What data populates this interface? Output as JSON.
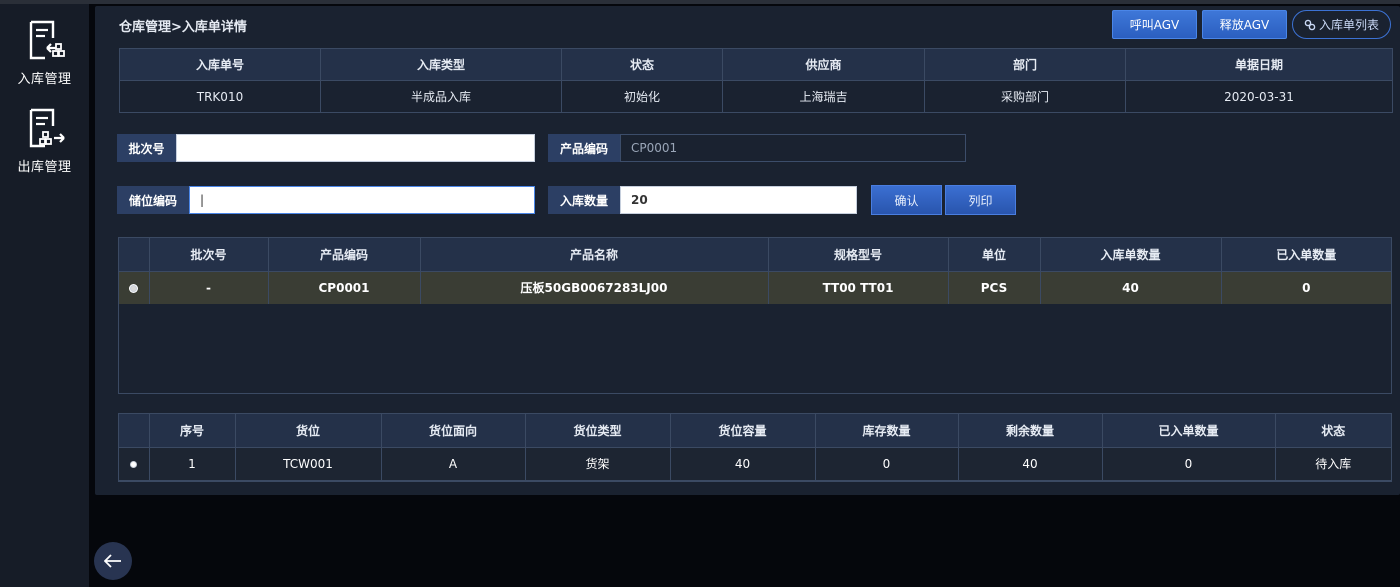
{
  "sidebar": {
    "items": [
      {
        "label": "入库管理",
        "icon": "inbound-doc-icon"
      },
      {
        "label": "出库管理",
        "icon": "outbound-doc-icon"
      }
    ]
  },
  "breadcrumb": "仓库管理>入库单详情",
  "toolbar": {
    "call_agv": "呼叫AGV",
    "release_agv": "释放AGV",
    "list": "入库单列表"
  },
  "order": {
    "headers": [
      "入库单号",
      "入库类型",
      "状态",
      "供应商",
      "部门",
      "单据日期"
    ],
    "values": [
      "TRK010",
      "半成品入库",
      "初始化",
      "上海瑞吉",
      "采购部门",
      "2020-03-31"
    ]
  },
  "form": {
    "batch_label": "批次号",
    "batch_value": "",
    "product_code_label": "产品编码",
    "product_code_value": "CP0001",
    "location_label": "储位编码",
    "location_value": "|",
    "qty_label": "入库数量",
    "qty_value": "20",
    "confirm": "确认",
    "print": "列印"
  },
  "products": {
    "headers": [
      "",
      "批次号",
      "产品编码",
      "产品名称",
      "规格型号",
      "单位",
      "入库单数量",
      "已入单数量"
    ],
    "rows": [
      [
        "",
        "-",
        "CP0001",
        "压板50GB0067283LJ00",
        "TT00 TT01",
        "PCS",
        "40",
        "0"
      ]
    ]
  },
  "locations": {
    "headers": [
      "",
      "序号",
      "货位",
      "货位面向",
      "货位类型",
      "货位容量",
      "库存数量",
      "剩余数量",
      "已入单数量",
      "状态"
    ],
    "rows": [
      [
        "",
        "1",
        "TCW001",
        "A",
        "货架",
        "40",
        "0",
        "40",
        "0",
        "待入库"
      ]
    ]
  }
}
